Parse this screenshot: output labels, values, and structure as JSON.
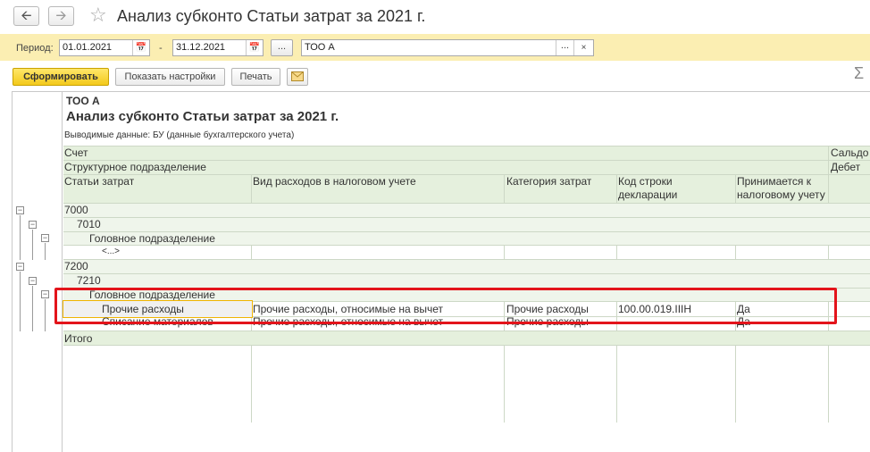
{
  "window": {
    "title": "Анализ субконто Статьи затрат  за 2021 г.",
    "back_icon": "arrow-left-icon",
    "forward_icon": "arrow-right-icon",
    "favorite_icon": "star-icon"
  },
  "filter": {
    "period_label": "Период:",
    "date_from": "01.01.2021",
    "date_to": "31.12.2021",
    "dash": "-",
    "dots_label": "...",
    "organization": "ТОО А",
    "org_select_label": "...",
    "org_clear_label": "×"
  },
  "toolbar": {
    "generate_label": "Сформировать",
    "settings_label": "Показать настройки",
    "print_label": "Печать",
    "email_icon": "envelope-icon",
    "sum_icon": "Σ"
  },
  "report": {
    "org": "ТОО А",
    "title": "Анализ субконто Статьи затрат  за 2021 г.",
    "output_data": "Выводимые данные:  БУ (данные бухгалтерского учета)",
    "headers": {
      "account": "Счет",
      "saldo": "Сальдо",
      "division": "Структурное подразделение",
      "debit": "Дебет",
      "cost_item": "Статьи затрат",
      "tax_expense_type": "Вид расходов в налоговом учете",
      "cost_category": "Категория затрат",
      "decl_line_1": "Код строки",
      "decl_line_2": "декларации",
      "accepted_1": "Принимается к",
      "accepted_2": "налоговому учету"
    },
    "rows": {
      "acc_7000": "7000",
      "acc_7010": "7010",
      "div_1": "Головное подразделение",
      "empty_item": "<...>",
      "acc_7200": "7200",
      "acc_7210": "7210",
      "div_2": "Головное подразделение",
      "r1_item": "Прочие расходы",
      "r1_tax": "Прочие расходы, относимые на вычет",
      "r1_cat": "Прочие расходы",
      "r1_code": "100.00.019.IIIН",
      "r1_acc": "Да",
      "r2_item": "Списание материалов",
      "r2_tax": "Прочие расходы, относимые на вычет",
      "r2_cat": "Прочие расходы",
      "r2_acc": "Да",
      "total": "Итого"
    }
  },
  "colors": {
    "filter_bg": "#fbeeb2",
    "header_bg": "#e5f0dd",
    "primary_button": "#f3c91b",
    "highlight_red": "#e3141b",
    "highlight_yellow": "#f0b400"
  }
}
